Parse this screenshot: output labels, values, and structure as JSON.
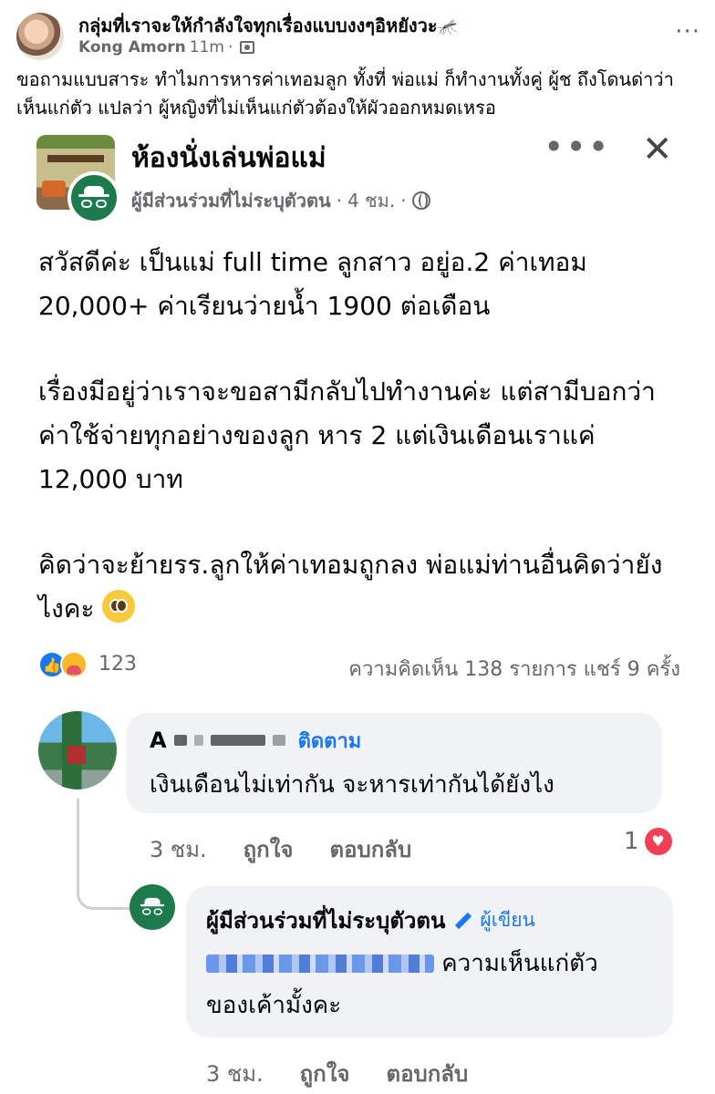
{
  "outer_post": {
    "group_name": "กลุ่มที่เราจะให้กำลังใจทุกเรื่องแบบงงๆอิหยังวะ",
    "group_emoji": "🦟",
    "author": "Kong Amorn",
    "time": "11m",
    "dot": "·",
    "more": "···",
    "text": "ขอถามแบบสาระ  ทำไมการหารค่าเทอมลูก ทั้งที่  พ่อแม่ ก็ทำงานทั้งคู่ ผู้ช ถึงโดนด่าว่าเห็นแก่ตัว แปลว่า ผู้หญิงที่ไม่เห็นแก่ตัวต้องให้ผัวออกหมดเหรอ"
  },
  "inner_post": {
    "group_name": "ห้องนั่งเล่นพ่อแม่",
    "poster": "ผู้มีส่วนร่วมที่ไม่ระบุตัวตน",
    "time": "4 ชม.",
    "dot": "·",
    "more": "•••",
    "close": "✕",
    "paragraphs": [
      "สวัสดีค่ะ เป็นแม่ full time ลูกสาว อยู่อ.2 ค่าเทอม 20,000+  ค่าเรียนว่ายน้ำ 1900 ต่อเดือน",
      "เรื่องมีอยู่ว่าเราจะขอสามีกลับไปทำงานค่ะ แต่สามีบอกว่าค่าใช้จ่ายทุกอย่างของลูก หาร 2 แต่เงินเดือนเราแค่ 12,000 บาท",
      "คิดว่าจะย้ายรร.ลูกให้ค่าเทอมถูกลง พ่อแม่ท่านอื่นคิดว่ายังไงคะ"
    ],
    "reaction_count": "123",
    "stats": "ความคิดเห็น 138 รายการ  แชร์ 9 ครั้ง"
  },
  "comment1": {
    "name_initial": "A",
    "follow": "ติดตาม",
    "text": "เงินเดือนไม่เท่ากัน จะหารเท่ากันได้ยังไง",
    "time": "3 ชม.",
    "like": "ถูกใจ",
    "reply": "ตอบกลับ",
    "like_count": "1"
  },
  "comment2": {
    "name": "ผู้มีส่วนร่วมที่ไม่ระบุตัวตน",
    "author_badge": "ผู้เขียน",
    "text_after_mention": "ความเห็นแก่ตัว",
    "text_line2": "ของเค้ามั้งคะ",
    "time": "3 ชม.",
    "like": "ถูกใจ",
    "reply": "ตอบกลับ"
  }
}
